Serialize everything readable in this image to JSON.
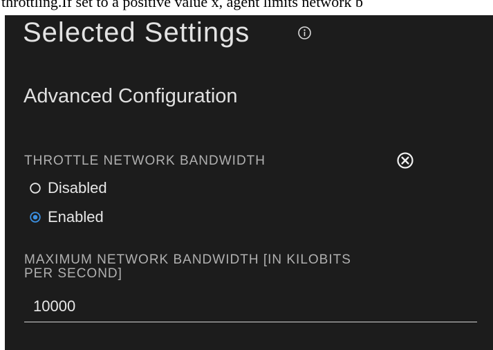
{
  "doc": {
    "cut_text": "throttling.If set to a positive value x, agent limits network b"
  },
  "panel": {
    "title": "Selected Settings",
    "section_title": "Advanced Configuration"
  },
  "throttle": {
    "label": "THROTTLE NETWORK BANDWIDTH",
    "options": [
      {
        "label": "Disabled",
        "selected": false
      },
      {
        "label": "Enabled",
        "selected": true
      }
    ]
  },
  "max_bandwidth": {
    "label": "MAXIMUM NETWORK BANDWIDTH [IN KILOBITS PER SECOND]",
    "value": "10000"
  },
  "icons": {
    "info": "info-icon",
    "clear": "close-circle-icon",
    "radio_off": "radio-unselected-icon",
    "radio_on": "radio-selected-icon"
  },
  "colors": {
    "panel_bg": "#1c1c1c",
    "accent": "#3b8fe0",
    "text": "#e6e6e6",
    "muted_label": "#b0b0b0"
  }
}
